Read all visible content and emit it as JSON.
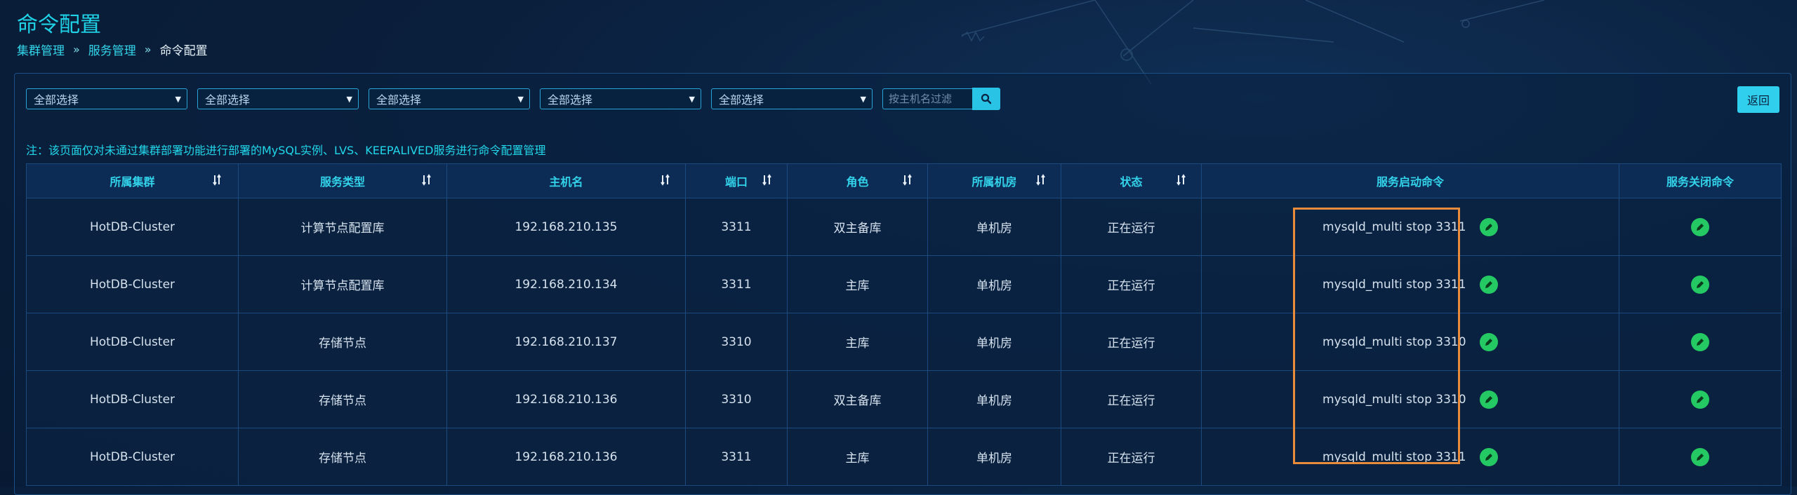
{
  "page": {
    "title": "命令配置",
    "breadcrumb": [
      "集群管理",
      "服务管理",
      "命令配置"
    ]
  },
  "filters": {
    "selects": [
      "全部选择",
      "全部选择",
      "全部选择",
      "全部选择",
      "全部选择"
    ],
    "search_placeholder": "按主机名过滤",
    "search_icon": "search-icon"
  },
  "back_label": "返回",
  "note": "注：该页面仅对未通过集群部署功能进行部署的MySQL实例、LVS、KEEPALIVED服务进行命令配置管理",
  "table": {
    "headers": [
      "所属集群",
      "服务类型",
      "主机名",
      "端口",
      "角色",
      "所属机房",
      "状态",
      "服务启动命令",
      "服务关闭命令"
    ],
    "rows": [
      {
        "cluster": "HotDB-Cluster",
        "type": "计算节点配置库",
        "host": "192.168.210.135",
        "port": "3311",
        "role": "双主备库",
        "room": "单机房",
        "status": "正在运行",
        "start_cmd": "mysqld_multi stop 3311"
      },
      {
        "cluster": "HotDB-Cluster",
        "type": "计算节点配置库",
        "host": "192.168.210.134",
        "port": "3311",
        "role": "主库",
        "room": "单机房",
        "status": "正在运行",
        "start_cmd": "mysqld_multi stop 3311"
      },
      {
        "cluster": "HotDB-Cluster",
        "type": "存储节点",
        "host": "192.168.210.137",
        "port": "3310",
        "role": "主库",
        "room": "单机房",
        "status": "正在运行",
        "start_cmd": "mysqld_multi stop 3310"
      },
      {
        "cluster": "HotDB-Cluster",
        "type": "存储节点",
        "host": "192.168.210.136",
        "port": "3310",
        "role": "双主备库",
        "room": "单机房",
        "status": "正在运行",
        "start_cmd": "mysqld_multi stop 3310"
      },
      {
        "cluster": "HotDB-Cluster",
        "type": "存储节点",
        "host": "192.168.210.136",
        "port": "3311",
        "role": "主库",
        "room": "单机房",
        "status": "正在运行",
        "start_cmd": "mysqld_multi stop 3311"
      }
    ]
  },
  "colors": {
    "accent": "#1fd2e6",
    "running": "#3ff07a",
    "edit_button": "#25c964",
    "highlight": "#e88c3c"
  }
}
